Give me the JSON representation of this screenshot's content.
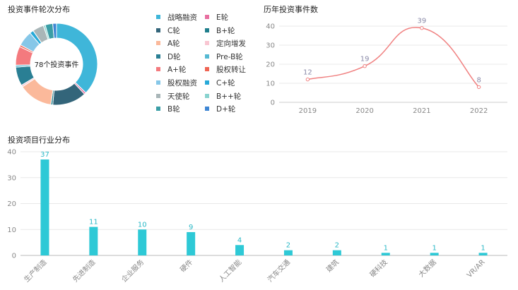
{
  "titles": {
    "donut": "投资事件轮次分布",
    "line": "历年投资事件数",
    "bar": "投资项目行业分布"
  },
  "chart_data": [
    {
      "type": "pie",
      "variant": "donut",
      "center_label": "78个投资事件",
      "legend_columns": 2,
      "slices": [
        {
          "name": "战略融资",
          "value": 25,
          "color": "#3fb6d9"
        },
        {
          "name": "E轮",
          "value": 0.5,
          "color": "#e86fa0"
        },
        {
          "name": "C轮",
          "value": 9,
          "color": "#33657a"
        },
        {
          "name": "B+轮",
          "value": 0.5,
          "color": "#1f7e8c"
        },
        {
          "name": "A轮",
          "value": 9,
          "color": "#fbb99b"
        },
        {
          "name": "定向增发",
          "value": 0.5,
          "color": "#f9c6d2"
        },
        {
          "name": "D轮",
          "value": 5,
          "color": "#2a7f94"
        },
        {
          "name": "Pre-B轮",
          "value": 0.5,
          "color": "#55b9d2"
        },
        {
          "name": "A+轮",
          "value": 5,
          "color": "#f47a7e"
        },
        {
          "name": "股权转让",
          "value": 0.5,
          "color": "#ef6453"
        },
        {
          "name": "股权融资",
          "value": 4,
          "color": "#86c7e8"
        },
        {
          "name": "C+轮",
          "value": 1,
          "color": "#27a9d8"
        },
        {
          "name": "天使轮",
          "value": 3,
          "color": "#a9b6b8"
        },
        {
          "name": "B++轮",
          "value": 0.5,
          "color": "#89d3cf"
        },
        {
          "name": "B轮",
          "value": 2,
          "color": "#3a9ea6"
        },
        {
          "name": "D+轮",
          "value": 1,
          "color": "#3e86d4"
        }
      ]
    },
    {
      "type": "line",
      "smooth": true,
      "x": [
        "2019",
        "2020",
        "2021",
        "2022"
      ],
      "series": [
        {
          "values": [
            12,
            19,
            39,
            8
          ],
          "color": "#f08080"
        }
      ],
      "ylim": [
        0,
        40
      ],
      "yticks": [
        0,
        10,
        20,
        30,
        40
      ],
      "grid": true
    },
    {
      "type": "bar",
      "categories": [
        "生产制造",
        "先进制造",
        "企业服务",
        "硬件",
        "人工智能",
        "汽车交通",
        "建筑",
        "硬科技",
        "大数据",
        "VR/AR"
      ],
      "values": [
        37,
        11,
        10,
        9,
        4,
        2,
        2,
        1,
        1,
        1
      ],
      "color": "#2ec9d6",
      "ylim": [
        0,
        40
      ],
      "yticks": [
        0,
        10,
        20,
        30,
        40
      ],
      "grid": true,
      "xtick_rotation": -45
    }
  ]
}
